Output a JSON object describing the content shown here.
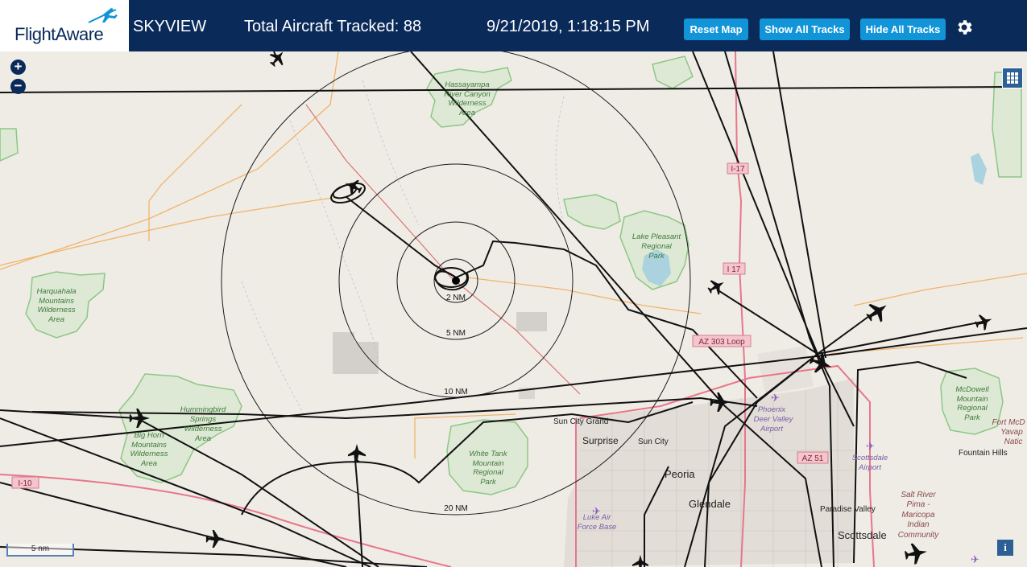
{
  "header": {
    "logo_text": "FlightAware",
    "app_title": "SKYVIEW",
    "aircraft_tracked": "Total Aircraft Tracked: 88",
    "datetime": "9/21/2019, 1:18:15 PM",
    "buttons": {
      "reset_map": "Reset Map",
      "show_all_tracks": "Show All Tracks",
      "hide_all_tracks": "Hide All Tracks"
    }
  },
  "map": {
    "range_rings": [
      "2 NM",
      "5 NM",
      "10 NM",
      "20 NM"
    ],
    "scale_label": "5 nm",
    "zoom_in": "+",
    "zoom_out": "−",
    "info": "i",
    "places": {
      "hassayampa": [
        "Hassayampa",
        "River Canyon",
        "Wilderness",
        "Area"
      ],
      "harquahala": [
        "Harquahala",
        "Mountains",
        "Wilderness",
        "Area"
      ],
      "hummingbird": [
        "Hummingbird",
        "Springs",
        "Wilderness",
        "Area"
      ],
      "bighorn": [
        "Big Horn",
        "Mountains",
        "Wilderness",
        "Area"
      ],
      "lake_pleasant": [
        "Lake Pleasant",
        "Regional",
        "Park"
      ],
      "white_tank": [
        "White Tank",
        "Mountain",
        "Regional",
        "Park"
      ],
      "mcdowell": [
        "McDowell",
        "Mountain",
        "Regional",
        "Park"
      ],
      "sun_city_grand": "Sun City Grand",
      "surprise": "Surprise",
      "sun_city": "Sun City",
      "peoria": "Peoria",
      "glendale": "Glendale",
      "luke": [
        "Luke Air",
        "Force Base"
      ],
      "phoenix_deer_valley": [
        "Phoenix",
        "Deer Valley",
        "Airport"
      ],
      "scottsdale_airport": [
        "Scottsdale",
        "Airport"
      ],
      "paradise_valley": "Paradise Valley",
      "scottsdale": "Scottsdale",
      "fountain_hills": "Fountain Hills",
      "salt_river": [
        "Salt River",
        "Pima -",
        "Maricopa",
        "Indian",
        "Community"
      ],
      "fort_mcdowell": [
        "Fort McD",
        "Yavap",
        "Natic"
      ]
    },
    "shields": {
      "i17_north": "I-17",
      "i17_mid": "I 17",
      "az303": "AZ 303 Loop",
      "az51": "AZ 51",
      "i10": "I-10"
    }
  }
}
